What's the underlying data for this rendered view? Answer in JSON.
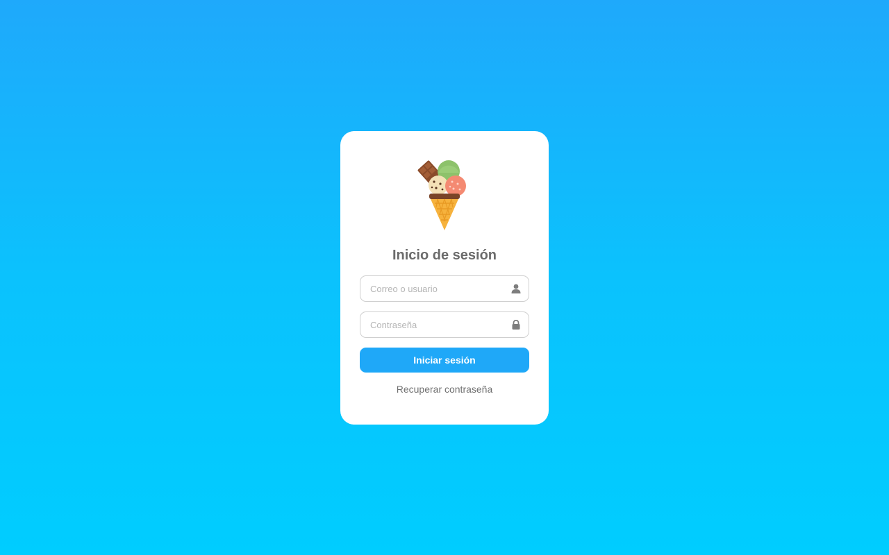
{
  "login": {
    "logo_icon": "ice-cream-cone-icon",
    "title": "Inicio de sesión",
    "user_field": {
      "placeholder": "Correo o usuario",
      "value": "",
      "icon": "user-icon"
    },
    "password_field": {
      "placeholder": "Contraseña",
      "value": "",
      "icon": "lock-icon"
    },
    "submit_label": "Iniciar sesión",
    "recover_link": "Recuperar contraseña"
  },
  "colors": {
    "background_top": "#1fa9fb",
    "background_bottom": "#00cdff",
    "button": "#1fa8f8",
    "card": "#ffffff"
  }
}
